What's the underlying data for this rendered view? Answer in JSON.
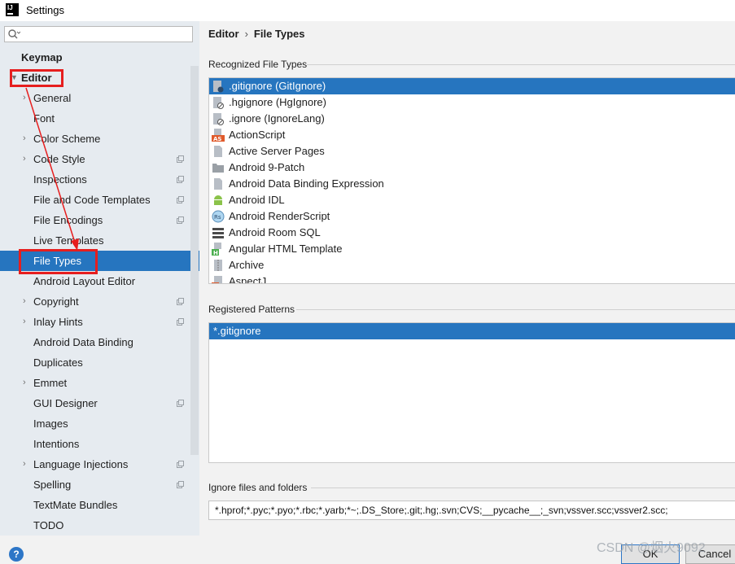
{
  "window": {
    "title": "Settings",
    "logo_text": "IJ"
  },
  "search": {
    "placeholder": "",
    "value": ""
  },
  "sidebar": {
    "items": [
      {
        "label": "Keymap",
        "level": 0,
        "bold": true
      },
      {
        "label": "Editor",
        "level": 0,
        "bold": true,
        "expanded": true
      },
      {
        "label": "General",
        "level": 1,
        "expandable": true
      },
      {
        "label": "Font",
        "level": 1
      },
      {
        "label": "Color Scheme",
        "level": 1,
        "expandable": true
      },
      {
        "label": "Code Style",
        "level": 1,
        "expandable": true,
        "project_icon": true
      },
      {
        "label": "Inspections",
        "level": 1,
        "project_icon": true
      },
      {
        "label": "File and Code Templates",
        "level": 1,
        "project_icon": true
      },
      {
        "label": "File Encodings",
        "level": 1,
        "project_icon": true
      },
      {
        "label": "Live Templates",
        "level": 1
      },
      {
        "label": "File Types",
        "level": 1,
        "selected": true
      },
      {
        "label": "Android Layout Editor",
        "level": 1
      },
      {
        "label": "Copyright",
        "level": 1,
        "expandable": true,
        "project_icon": true
      },
      {
        "label": "Inlay Hints",
        "level": 1,
        "expandable": true,
        "project_icon": true
      },
      {
        "label": "Android Data Binding",
        "level": 1
      },
      {
        "label": "Duplicates",
        "level": 1
      },
      {
        "label": "Emmet",
        "level": 1,
        "expandable": true
      },
      {
        "label": "GUI Designer",
        "level": 1,
        "project_icon": true
      },
      {
        "label": "Images",
        "level": 1
      },
      {
        "label": "Intentions",
        "level": 1
      },
      {
        "label": "Language Injections",
        "level": 1,
        "expandable": true,
        "project_icon": true
      },
      {
        "label": "Spelling",
        "level": 1,
        "project_icon": true
      },
      {
        "label": "TextMate Bundles",
        "level": 1
      },
      {
        "label": "TODO",
        "level": 1
      }
    ]
  },
  "breadcrumb": {
    "parent": "Editor",
    "separator": "›",
    "current": "File Types"
  },
  "recognized": {
    "title": "Recognized File Types",
    "items": [
      {
        "label": ".gitignore (GitIgnore)",
        "icon": "gitignore-icon",
        "selected": true
      },
      {
        "label": ".hgignore (HgIgnore)",
        "icon": "hgignore-icon"
      },
      {
        "label": ".ignore (IgnoreLang)",
        "icon": "ignore-icon"
      },
      {
        "label": "ActionScript",
        "icon": "actionscript-icon"
      },
      {
        "label": "Active Server Pages",
        "icon": "file-icon"
      },
      {
        "label": "Android 9-Patch",
        "icon": "folder-icon"
      },
      {
        "label": "Android Data Binding Expression",
        "icon": "file-icon"
      },
      {
        "label": "Android IDL",
        "icon": "android-icon"
      },
      {
        "label": "Android RenderScript",
        "icon": "renderscript-icon"
      },
      {
        "label": "Android Room SQL",
        "icon": "database-icon"
      },
      {
        "label": "Angular HTML Template",
        "icon": "html-icon"
      },
      {
        "label": "Archive",
        "icon": "archive-icon"
      },
      {
        "label": "AspectJ",
        "icon": "aspectj-icon"
      }
    ]
  },
  "patterns": {
    "title": "Registered Patterns",
    "items": [
      {
        "label": "*.gitignore",
        "selected": true
      }
    ]
  },
  "ignore": {
    "title": "Ignore files and folders",
    "value": "*.hprof;*.pyc;*.pyo;*.rbc;*.yarb;*~;.DS_Store;.git;.hg;.svn;CVS;__pycache__;_svn;vssver.scc;vssver2.scc;"
  },
  "buttons": {
    "ok": "OK",
    "cancel": "Cancel",
    "help": "?"
  },
  "watermark": "CSDN @烟火9092",
  "colors": {
    "selection": "#2675bf",
    "annotation": "#e61e1e",
    "sidebar_bg": "#e6ebf0"
  }
}
